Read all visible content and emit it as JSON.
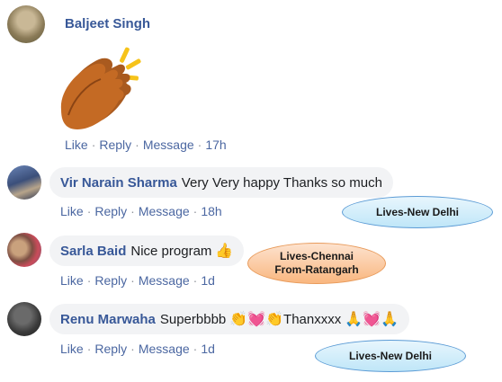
{
  "comments": [
    {
      "author": "Baljeet Singh",
      "text": "",
      "actions": {
        "like": "Like",
        "reply": "Reply",
        "message": "Message",
        "time": "17h"
      }
    },
    {
      "author": "Vir Narain Sharma",
      "text": "Very Very happy Thanks so much",
      "actions": {
        "like": "Like",
        "reply": "Reply",
        "message": "Message",
        "time": "18h"
      }
    },
    {
      "author": "Sarla Baid",
      "text": "Nice program",
      "actions": {
        "like": "Like",
        "reply": "Reply",
        "message": "Message",
        "time": "1d"
      }
    },
    {
      "author": "Renu Marwaha",
      "text_before": "Superbbbb",
      "text_after": "Thanxxxx",
      "actions": {
        "like": "Like",
        "reply": "Reply",
        "message": "Message",
        "time": "1d"
      }
    }
  ],
  "separator": "·",
  "callouts": [
    {
      "line1": "Lives-New Delhi",
      "line2": ""
    },
    {
      "line1": "Lives-Chennai",
      "line2": "From-Ratangarh"
    },
    {
      "line1": "Lives-New Delhi",
      "line2": ""
    }
  ],
  "emoji": {
    "thumbs": "👍",
    "clap": "👏",
    "heart": "💓",
    "pray": "🙏"
  },
  "colors": {
    "name_link": "#385898",
    "action_link": "#4b67a1",
    "bubble_bg": "#f2f3f5",
    "callout_blue": "#bfe6f8",
    "callout_orange": "#f9b77f"
  }
}
